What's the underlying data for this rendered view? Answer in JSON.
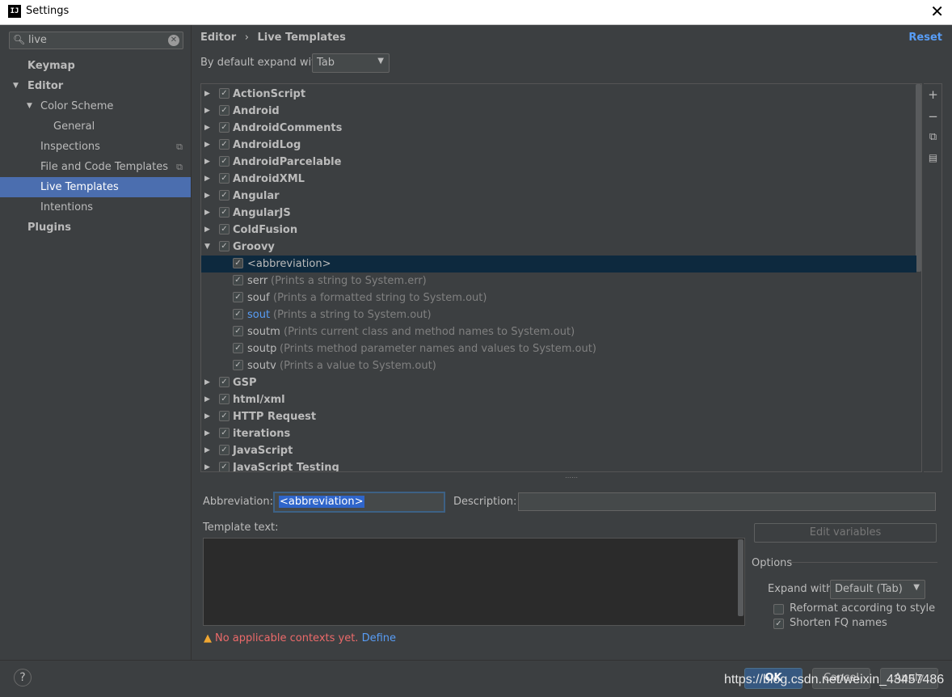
{
  "window": {
    "title": "Settings",
    "app_icon": "IJ"
  },
  "sidebar": {
    "search_value": "live",
    "items": [
      {
        "label": "Keymap"
      },
      {
        "label": "Editor"
      },
      {
        "label": "Color Scheme"
      },
      {
        "label": "General"
      },
      {
        "label": "Inspections"
      },
      {
        "label": "File and Code Templates"
      },
      {
        "label": "Live Templates"
      },
      {
        "label": "Intentions"
      },
      {
        "label": "Plugins"
      }
    ]
  },
  "header": {
    "crumb_parent": "Editor",
    "crumb_sep": "›",
    "crumb_current": "Live Templates",
    "reset": "Reset"
  },
  "expand": {
    "label": "By default expand with",
    "value": "Tab"
  },
  "tree": {
    "groups_top": [
      "ActionScript",
      "Android",
      "AndroidComments",
      "AndroidLog",
      "AndroidParcelable",
      "AndroidXML",
      "Angular",
      "AngularJS",
      "ColdFusion"
    ],
    "groovy": {
      "name": "Groovy",
      "children": [
        {
          "name": "<abbreviation>",
          "desc": ""
        },
        {
          "name": "serr",
          "desc": "(Prints a string to System.err)"
        },
        {
          "name": "souf",
          "desc": "(Prints a formatted string to System.out)"
        },
        {
          "name": "sout",
          "desc": "(Prints a string to System.out)"
        },
        {
          "name": "soutm",
          "desc": "(Prints current class and method names to System.out)"
        },
        {
          "name": "soutp",
          "desc": "(Prints method parameter names and values to System.out)"
        },
        {
          "name": "soutv",
          "desc": "(Prints a value to System.out)"
        }
      ]
    },
    "groups_bottom": [
      "GSP",
      "html/xml",
      "HTTP Request",
      "iterations",
      "JavaScript",
      "JavaScript Testing"
    ]
  },
  "editor": {
    "abbreviation_label": "Abbreviation:",
    "abbreviation_value": "<abbreviation>",
    "description_label": "Description:",
    "template_text_label": "Template text:",
    "edit_variables": "Edit variables",
    "options_label": "Options",
    "expand_with_label": "Expand with",
    "expand_with_value": "Default (Tab)",
    "reformat_label": "Reformat according to style",
    "shorten_label": "Shorten FQ names",
    "warning": "No applicable contexts yet.",
    "define": "Define"
  },
  "footer": {
    "help": "?",
    "ok": "OK",
    "cancel": "Cancel",
    "apply": "Apply",
    "watermark": "https://blog.csdn.net/weixin_43457486"
  }
}
